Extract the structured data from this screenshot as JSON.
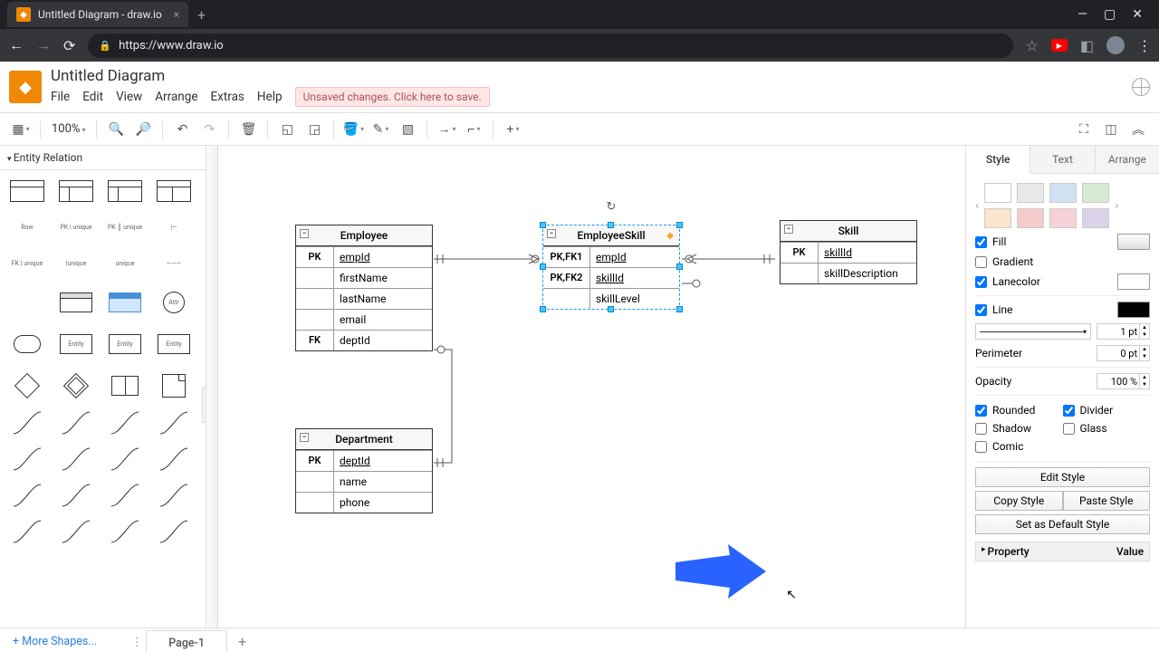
{
  "browser": {
    "tab_title": "Untitled Diagram - draw.io",
    "url": "https://www.draw.io"
  },
  "app": {
    "doc_title": "Untitled Diagram",
    "menus": [
      "File",
      "Edit",
      "View",
      "Arrange",
      "Extras",
      "Help"
    ],
    "unsaved_msg": "Unsaved changes. Click here to save."
  },
  "toolbar": {
    "zoom": "100%"
  },
  "sidebar": {
    "section": "Entity Relation",
    "row_label": "Row",
    "more_shapes": "+ More Shapes..."
  },
  "canvas": {
    "tables": {
      "employee": {
        "title": "Employee",
        "rows": [
          {
            "key": "PK",
            "field": "empId",
            "pk": true
          },
          {
            "key": "",
            "field": "firstName"
          },
          {
            "key": "",
            "field": "lastName"
          },
          {
            "key": "",
            "field": "email"
          },
          {
            "key": "FK",
            "field": "deptId"
          }
        ]
      },
      "empskill": {
        "title": "EmployeeSkill",
        "rows": [
          {
            "key": "PK,FK1",
            "field": "empId",
            "pk": true
          },
          {
            "key": "PK,FK2",
            "field": "skillId",
            "pk": true
          },
          {
            "key": "",
            "field": "skillLevel"
          }
        ]
      },
      "skill": {
        "title": "Skill",
        "rows": [
          {
            "key": "PK",
            "field": "skillId",
            "pk": true
          },
          {
            "key": "",
            "field": "skillDescription"
          }
        ]
      },
      "department": {
        "title": "Department",
        "rows": [
          {
            "key": "PK",
            "field": "deptId",
            "pk": true
          },
          {
            "key": "",
            "field": "name"
          },
          {
            "key": "",
            "field": "phone"
          }
        ]
      }
    }
  },
  "right_panel": {
    "tabs": [
      "Style",
      "Text",
      "Arrange"
    ],
    "swatches_top": [
      "#ffffff",
      "#e8e8e8",
      "#cfe2f3",
      "#d9ead3"
    ],
    "swatches_bottom": [
      "#fce5cd",
      "#f4cccc",
      "#f5d0d8",
      "#d9d2e9"
    ],
    "fill_label": "Fill",
    "gradient_label": "Gradient",
    "lanecolor_label": "Lanecolor",
    "line_label": "Line",
    "line_width": "1 pt",
    "perimeter_label": "Perimeter",
    "perimeter_val": "0 pt",
    "opacity_label": "Opacity",
    "opacity_val": "100 %",
    "rounded_label": "Rounded",
    "divider_label": "Divider",
    "shadow_label": "Shadow",
    "glass_label": "Glass",
    "comic_label": "Comic",
    "edit_style": "Edit Style",
    "copy_style": "Copy Style",
    "paste_style": "Paste Style",
    "default_style": "Set as Default Style",
    "property_label": "Property",
    "value_label": "Value"
  },
  "footer": {
    "page": "Page-1"
  }
}
